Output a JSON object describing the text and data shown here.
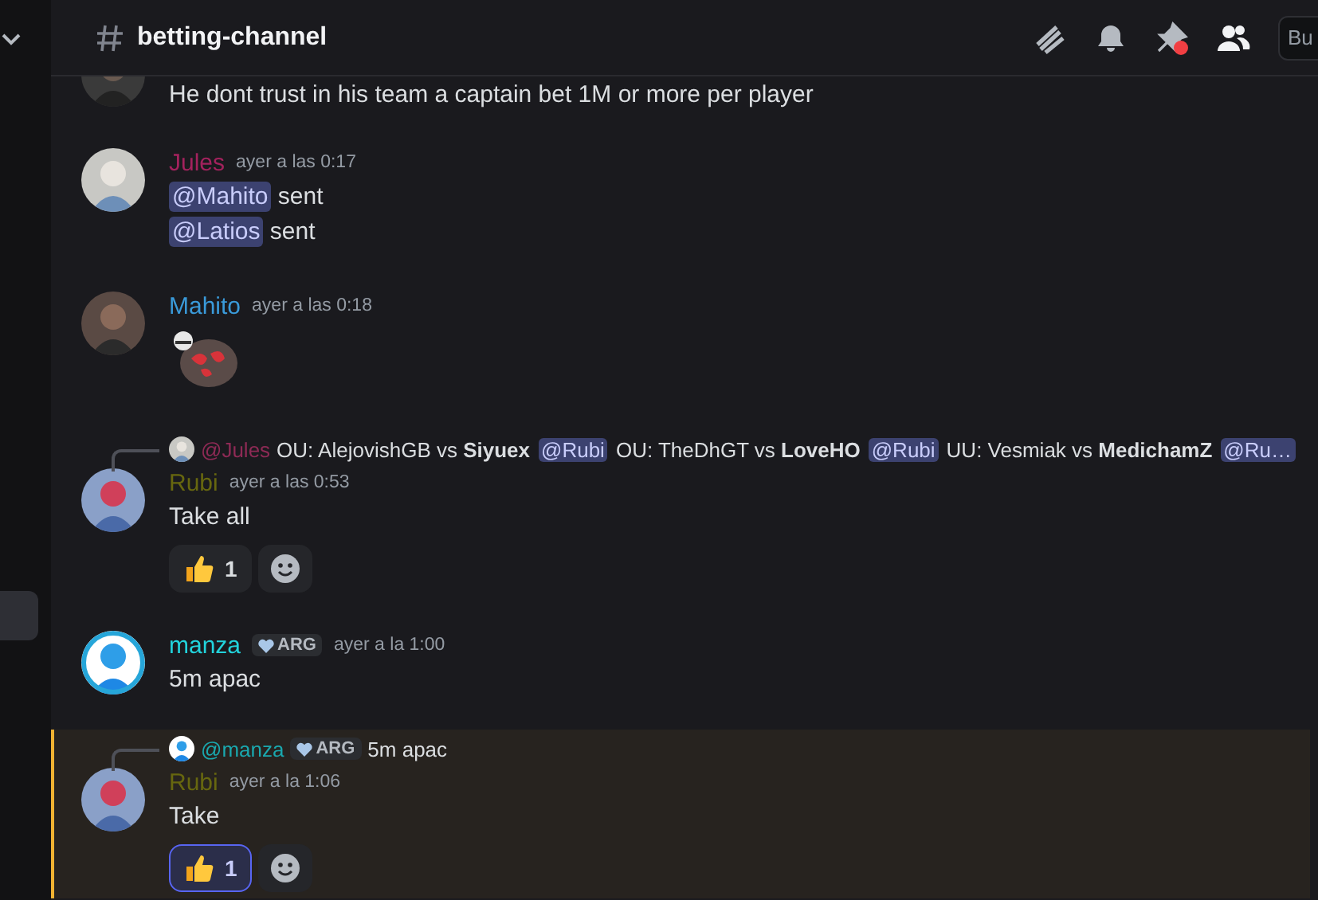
{
  "header": {
    "channel": "betting-channel",
    "search_placeholder": "Bu",
    "pins_unread": true
  },
  "messages": [
    {
      "kind": "continuation",
      "highlighted": false,
      "lines": [
        [
          {
            "kind": "text",
            "text": "He dont trust in his team a captain bet 1M or more per player"
          }
        ]
      ]
    },
    {
      "kind": "message",
      "highlighted": false,
      "author": "Jules",
      "color": "#a3225d",
      "time": "ayer a las 0:17",
      "lines": [
        [
          {
            "kind": "mention",
            "text": "@Mahito"
          },
          {
            "kind": "text",
            "text": " sent"
          }
        ],
        [
          {
            "kind": "mention",
            "text": "@Latios"
          },
          {
            "kind": "text",
            "text": " sent"
          }
        ]
      ]
    },
    {
      "kind": "message",
      "highlighted": false,
      "author": "Mahito",
      "color": "#3a9ad9",
      "time": "ayer a las 0:18",
      "sticker": true
    },
    {
      "kind": "message",
      "highlighted": false,
      "author": "Rubi",
      "color": "#67670f",
      "time": "ayer a las 0:53",
      "reply": {
        "author": "@Jules",
        "color": "#8e2a55",
        "parts": [
          {
            "kind": "text",
            "text": "OU: AlejovishGB vs **Siyuex**"
          },
          {
            "kind": "mention",
            "text": "@Rubi"
          },
          {
            "kind": "text",
            "text": "OU: TheDhGT vs **LoveHO**"
          },
          {
            "kind": "mention",
            "text": "@Rubi"
          },
          {
            "kind": "text",
            "text": "UU: Vesmiak vs **MedichamZ**"
          },
          {
            "kind": "mention",
            "text": "@Ru…"
          }
        ]
      },
      "lines": [
        [
          {
            "kind": "text",
            "text": "Take all"
          }
        ]
      ],
      "reactions": [
        {
          "count": "1",
          "selected": false
        }
      ]
    },
    {
      "kind": "message",
      "highlighted": false,
      "author": "manza",
      "color": "#22d3dc",
      "tag": "ARG",
      "time": "ayer a la 1:00",
      "lines": [
        [
          {
            "kind": "text",
            "text": "5m apac"
          }
        ]
      ]
    },
    {
      "kind": "message",
      "highlighted": true,
      "author": "Rubi",
      "color": "#67670f",
      "time": "ayer a la 1:06",
      "reply": {
        "author": "@manza",
        "color": "#1aa8ae",
        "tag": "ARG",
        "parts": [
          {
            "kind": "text",
            "text": "5m apac"
          }
        ]
      },
      "lines": [
        [
          {
            "kind": "text",
            "text": "Take"
          }
        ]
      ],
      "reactions": [
        {
          "count": "1",
          "selected": true
        }
      ]
    }
  ]
}
